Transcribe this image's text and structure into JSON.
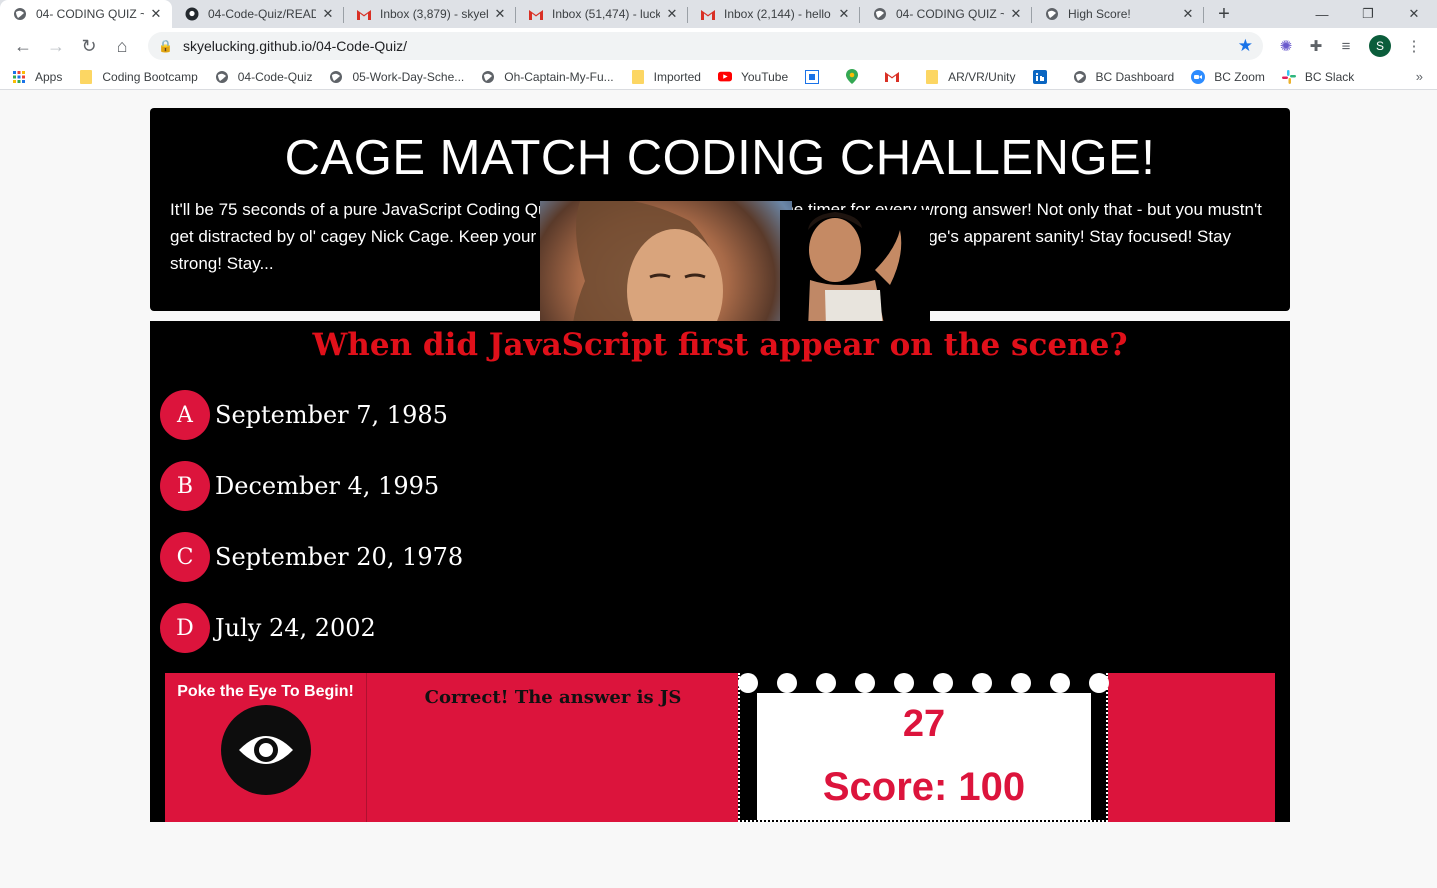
{
  "browser": {
    "tabs": [
      {
        "title": "04- CODING QUIZ ~",
        "icon": "globe-icon",
        "active": true
      },
      {
        "title": "04-Code-Quiz/READ",
        "icon": "github-icon",
        "active": false
      },
      {
        "title": "Inbox (3,879) - skyel",
        "icon": "gmail-icon",
        "active": false
      },
      {
        "title": "Inbox (51,474) - luck",
        "icon": "gmail-icon",
        "active": false
      },
      {
        "title": "Inbox (2,144) - hello",
        "icon": "gmail-icon",
        "active": false
      },
      {
        "title": "04- CODING QUIZ ~",
        "icon": "globe-icon",
        "active": false
      },
      {
        "title": "High Score!",
        "icon": "globe-icon",
        "active": false
      }
    ],
    "url": "skyelucking.github.io/04-Code-Quiz/",
    "profile_initial": "S",
    "bookmarks": [
      {
        "label": "Apps",
        "icon": "apps-icon"
      },
      {
        "label": "Coding Bootcamp",
        "icon": "folder-icon"
      },
      {
        "label": "04-Code-Quiz",
        "icon": "globe-icon"
      },
      {
        "label": "05-Work-Day-Sche...",
        "icon": "globe-icon"
      },
      {
        "label": "Oh-Captain-My-Fu...",
        "icon": "globe-icon"
      },
      {
        "label": "Imported",
        "icon": "folder-icon"
      },
      {
        "label": "YouTube",
        "icon": "youtube-icon"
      },
      {
        "label": "",
        "icon": "calendar-icon"
      },
      {
        "label": "",
        "icon": "maps-icon"
      },
      {
        "label": "",
        "icon": "gmail-icon"
      },
      {
        "label": "AR/VR/Unity",
        "icon": "folder-icon"
      },
      {
        "label": "",
        "icon": "linkedin-icon"
      },
      {
        "label": "BC Dashboard",
        "icon": "globe-icon"
      },
      {
        "label": "BC Zoom",
        "icon": "zoom-icon"
      },
      {
        "label": "BC Slack",
        "icon": "slack-icon"
      }
    ]
  },
  "header": {
    "title": "CAGE MATCH CODING CHALLENGE!",
    "description": "It'll be 75 seconds of a pure JavaScript Coding Quiz with a 10 second penalty off the timer for every wrong answer! Not only that - but you mustn't get distracted by ol' cagey Nick Cage. Keep your concentration, as time grows short so does Nick Cage's apparent sanity! Stay focused! Stay strong! Stay..."
  },
  "quiz": {
    "question": "When did JavaScript first appear on the scene?",
    "answers": [
      {
        "letter": "A",
        "text": "September 7, 1985"
      },
      {
        "letter": "B",
        "text": "December 4, 1995"
      },
      {
        "letter": "C",
        "text": "September 20, 1978"
      },
      {
        "letter": "D",
        "text": "July 24, 2002"
      }
    ]
  },
  "controls": {
    "begin_label": "Poke the Eye To Begin!",
    "feedback": "Correct! The answer is JS",
    "timer": "27",
    "score": "Score: 100"
  },
  "colors": {
    "accent": "#dc143c",
    "question": "#e0101a",
    "panel": "#000000"
  }
}
